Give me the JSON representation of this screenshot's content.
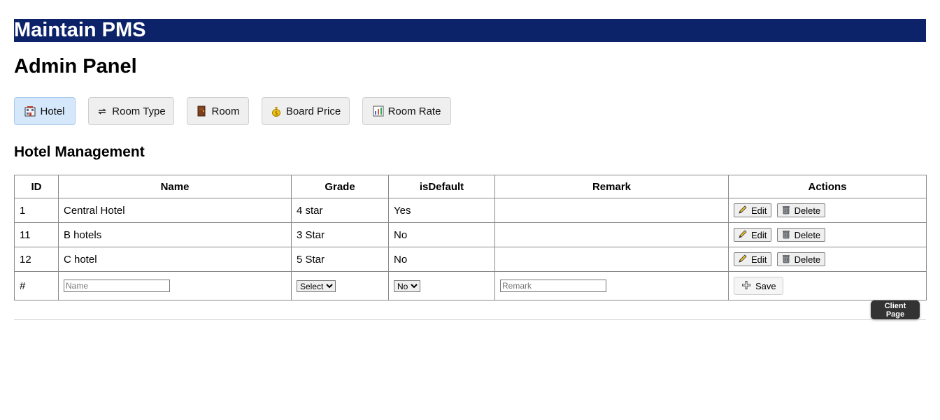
{
  "header": {
    "title": "Maintain PMS",
    "bg_color": "#0d2369"
  },
  "page": {
    "title": "Admin Panel",
    "section_title": "Hotel Management"
  },
  "tabs": [
    {
      "label": "Hotel",
      "icon": "hotel-icon",
      "active": true
    },
    {
      "label": "Room Type",
      "icon": "swap-arrows-icon",
      "active": false
    },
    {
      "label": "Room",
      "icon": "door-icon",
      "active": false
    },
    {
      "label": "Board Price",
      "icon": "money-bag-icon",
      "active": false
    },
    {
      "label": "Room Rate",
      "icon": "bar-chart-icon",
      "active": false
    }
  ],
  "table": {
    "columns": [
      "ID",
      "Name",
      "Grade",
      "isDefault",
      "Remark",
      "Actions"
    ],
    "rows": [
      {
        "id": "1",
        "name": "Central Hotel",
        "grade": "4 star",
        "is_default": "Yes",
        "remark": ""
      },
      {
        "id": "11",
        "name": "B hotels",
        "grade": "3 Star",
        "is_default": "No",
        "remark": ""
      },
      {
        "id": "12",
        "name": "C hotel",
        "grade": "5 Star",
        "is_default": "No",
        "remark": ""
      }
    ],
    "edit_label": "Edit",
    "delete_label": "Delete",
    "new_row": {
      "id": "#",
      "name_placeholder": "Name",
      "grade_selected": "Select",
      "is_default_selected": "No",
      "remark_placeholder": "Remark",
      "save_label": "Save"
    }
  },
  "client_page_button": "Client Page"
}
